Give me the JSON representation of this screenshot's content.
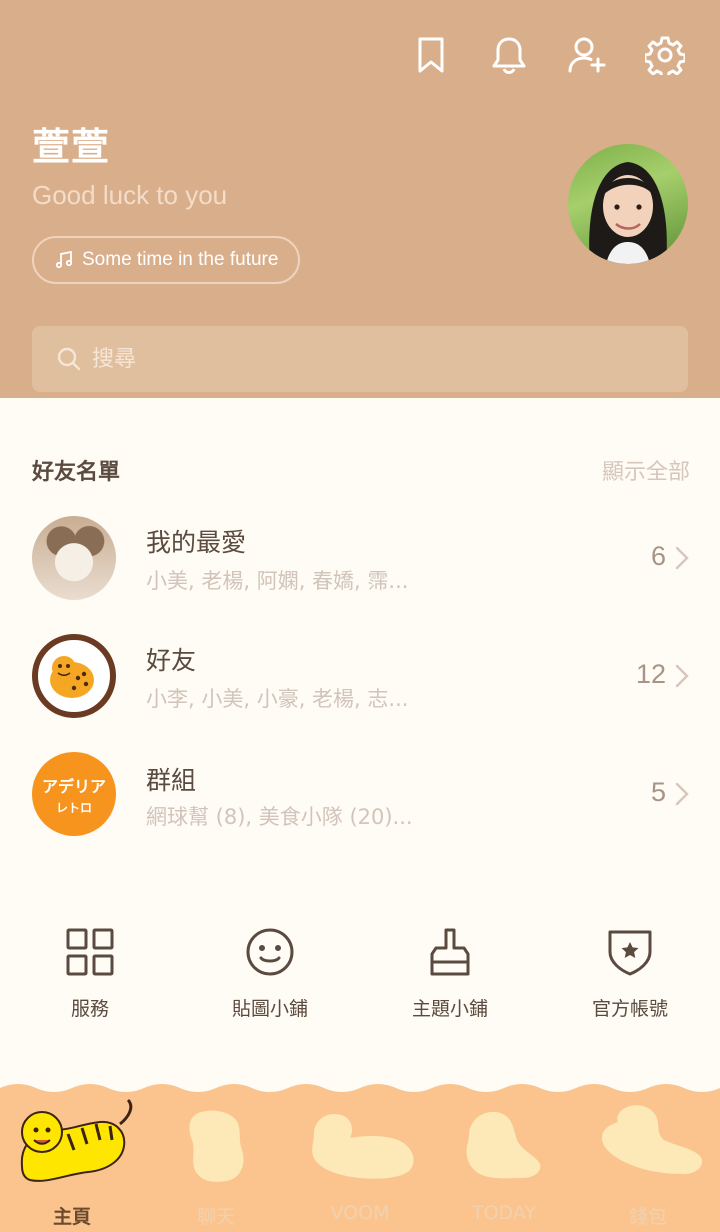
{
  "header": {
    "profile_name": "萱萱",
    "status_message": "Good luck to you",
    "music_title": "Some time in the future",
    "search_placeholder": "搜尋"
  },
  "friends": {
    "title": "好友名單",
    "show_all": "顯示全部",
    "rows": [
      {
        "title": "我的最愛",
        "subtitle": "小美, 老楊, 阿嫻, 春嬌, 霈...",
        "count": "6"
      },
      {
        "title": "好友",
        "subtitle": "小李, 小美, 小豪, 老楊, 志...",
        "count": "12"
      },
      {
        "title": "群組",
        "subtitle": "網球幫 (8), 美食小隊 (20)...",
        "count": "5"
      }
    ],
    "group_logo": {
      "line1": "アデリア",
      "line2": "レトロ"
    }
  },
  "shortcuts": [
    {
      "label": "服務",
      "icon": "grid-icon"
    },
    {
      "label": "貼圖小鋪",
      "icon": "smiley-icon"
    },
    {
      "label": "主題小鋪",
      "icon": "brush-icon"
    },
    {
      "label": "官方帳號",
      "icon": "shield-star-icon"
    }
  ],
  "bottom_nav": [
    {
      "label": "主頁",
      "active": true
    },
    {
      "label": "聊天",
      "active": false
    },
    {
      "label": "VOOM",
      "active": false
    },
    {
      "label": "TODAY",
      "active": false
    },
    {
      "label": "錢包",
      "active": false
    }
  ],
  "colors": {
    "header_bg": "#d9ae8b",
    "page_bg": "#fefcf5",
    "nav_bg": "#fbc48f",
    "text_dark": "#5b4a3f",
    "text_muted": "#d2c4ba",
    "group_orange": "#f7941e"
  }
}
